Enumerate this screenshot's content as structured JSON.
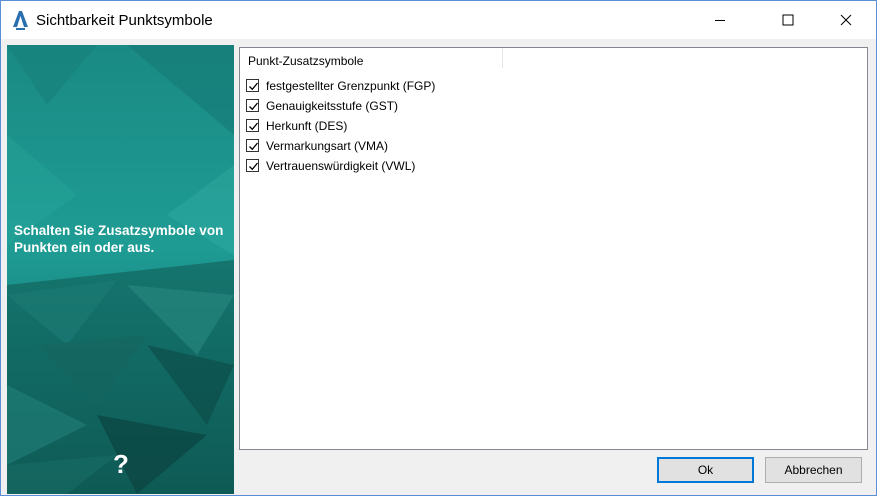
{
  "window": {
    "title": "Sichtbarkeit Punktsymbole",
    "accent": "#0078d7"
  },
  "side_panel": {
    "text": "Schalten Sie Zusatzsymbole von Punkten ein oder aus.",
    "help_glyph": "?"
  },
  "list": {
    "header": "Punkt-Zusatzsymbole",
    "items": [
      {
        "label": "festgestellter Grenzpunkt (FGP)",
        "checked": true
      },
      {
        "label": "Genauigkeitsstufe (GST)",
        "checked": true
      },
      {
        "label": "Herkunft (DES)",
        "checked": true
      },
      {
        "label": "Vermarkungsart (VMA)",
        "checked": true
      },
      {
        "label": "Vertrauenswürdigkeit (VWL)",
        "checked": true
      }
    ]
  },
  "buttons": {
    "ok": "Ok",
    "cancel": "Abbrechen"
  }
}
